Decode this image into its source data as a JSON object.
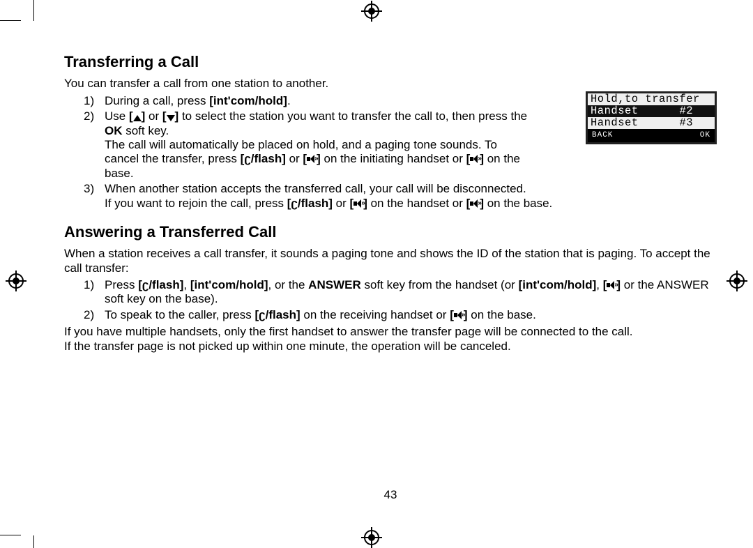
{
  "page_number": "43",
  "section1": {
    "heading": "Transferring a Call",
    "intro": "You can transfer a call from one station to another.",
    "steps": [
      {
        "pre": "During a call, press ",
        "b1": "int'com/hold",
        "post": "."
      },
      {
        "line1_a": "Use ",
        "line1_b": " or ",
        "line1_c": " to select the station you want to transfer the call to, then press the ",
        "ok": "OK",
        "softkey": " soft key.",
        "line2_a": "The call will automatically be placed on hold, and a paging tone sounds. To cancel the transfer, press ",
        "flash": "/flash]",
        "line2_b": "  or ",
        "line2_c": " on the initiating handset or ",
        "line2_d": " on the base."
      },
      {
        "line1": "When another station accepts the transferred call, your call will be disconnected.",
        "line2_a": "If you want to rejoin the call, press ",
        "flash": "/flash]",
        "line2_b": " or ",
        "line2_c": " on the handset or ",
        "line2_d": " on the base."
      }
    ]
  },
  "lcd": {
    "row1": "Hold,to transfer",
    "row2_l": "Handset",
    "row2_r": "#2",
    "row3_l": "Handset",
    "row3_r": "#3",
    "soft_l": "BACK",
    "soft_r": "OK"
  },
  "section2": {
    "heading": "Answering a Transferred Call",
    "intro": "When a station receives a call transfer, it sounds a paging tone and shows the ID of the station that is paging. To accept the call transfer:",
    "steps": [
      {
        "a": "Press ",
        "flash": "/flash]",
        "b": ", ",
        "intcom": "[int'com/hold]",
        "c": ", or the ",
        "answer": "ANSWER",
        "d": " soft key from the handset (or ",
        "intcom2": "[int'com/hold]",
        "e": ", ",
        "f": " or the ANSWER soft key on the base)."
      },
      {
        "a": "To speak to the caller, press ",
        "flash": "/flash]",
        "b": " on the receiving handset or ",
        "c": " on the base."
      }
    ],
    "note1": "If you have multiple handsets, only the first handset to answer the transfer page will be connected to the call.",
    "note2": "If the transfer page is not picked up within one minute, the operation will be canceled."
  },
  "icons": {
    "up": "[▲]",
    "down": "[▼]",
    "phone_open": "[",
    "speaker": "[🔊]"
  }
}
